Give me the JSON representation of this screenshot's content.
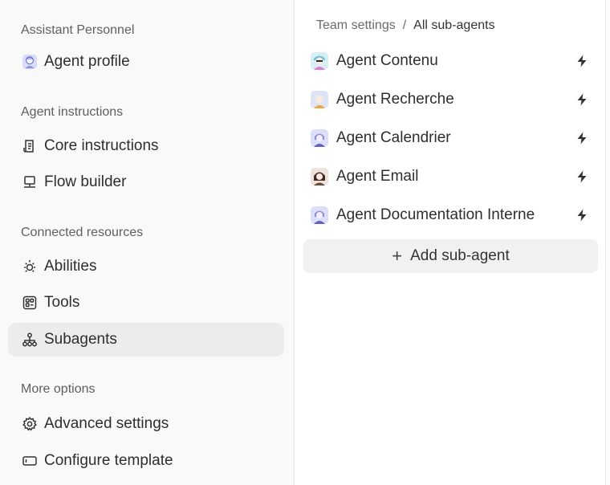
{
  "sidebar": {
    "sections": [
      {
        "label": "Assistant Personnel",
        "items": [
          {
            "label": "Agent profile",
            "icon": "avatar-icon"
          }
        ]
      },
      {
        "label": "Agent instructions",
        "items": [
          {
            "label": "Core instructions",
            "icon": "document-icon"
          },
          {
            "label": "Flow builder",
            "icon": "monitor-icon"
          }
        ]
      },
      {
        "label": "Connected resources",
        "items": [
          {
            "label": "Abilities",
            "icon": "sparkle-sun-icon"
          },
          {
            "label": "Tools",
            "icon": "grid-box-icon"
          },
          {
            "label": "Subagents",
            "icon": "hierarchy-icon",
            "active": true
          }
        ]
      },
      {
        "label": "More options",
        "items": [
          {
            "label": "Advanced settings",
            "icon": "gear-icon"
          },
          {
            "label": "Configure template",
            "icon": "template-icon"
          }
        ]
      }
    ]
  },
  "breadcrumb": {
    "root": "Team settings",
    "separator": "/",
    "current": "All sub-agents"
  },
  "agents": [
    {
      "name": "Agent Contenu",
      "avatar_color": "#6fc3d9",
      "accent": "#e27ad8"
    },
    {
      "name": "Agent Recherche",
      "avatar_color": "#e8c96a",
      "accent": "#f0a63a"
    },
    {
      "name": "Agent Calendrier",
      "avatar_color": "#8c8fe0",
      "accent": "#5e64c9"
    },
    {
      "name": "Agent Email",
      "avatar_color": "#c59a7a",
      "accent": "#6b4a3a"
    },
    {
      "name": "Agent Documentation Interne",
      "avatar_color": "#8c8fe0",
      "accent": "#5e64c9"
    }
  ],
  "add_button": {
    "label": "Add sub-agent"
  },
  "colors": {
    "sidebar_bg": "#f9f9f9",
    "active_bg": "#ececec",
    "button_bg": "#f1f1f1"
  }
}
